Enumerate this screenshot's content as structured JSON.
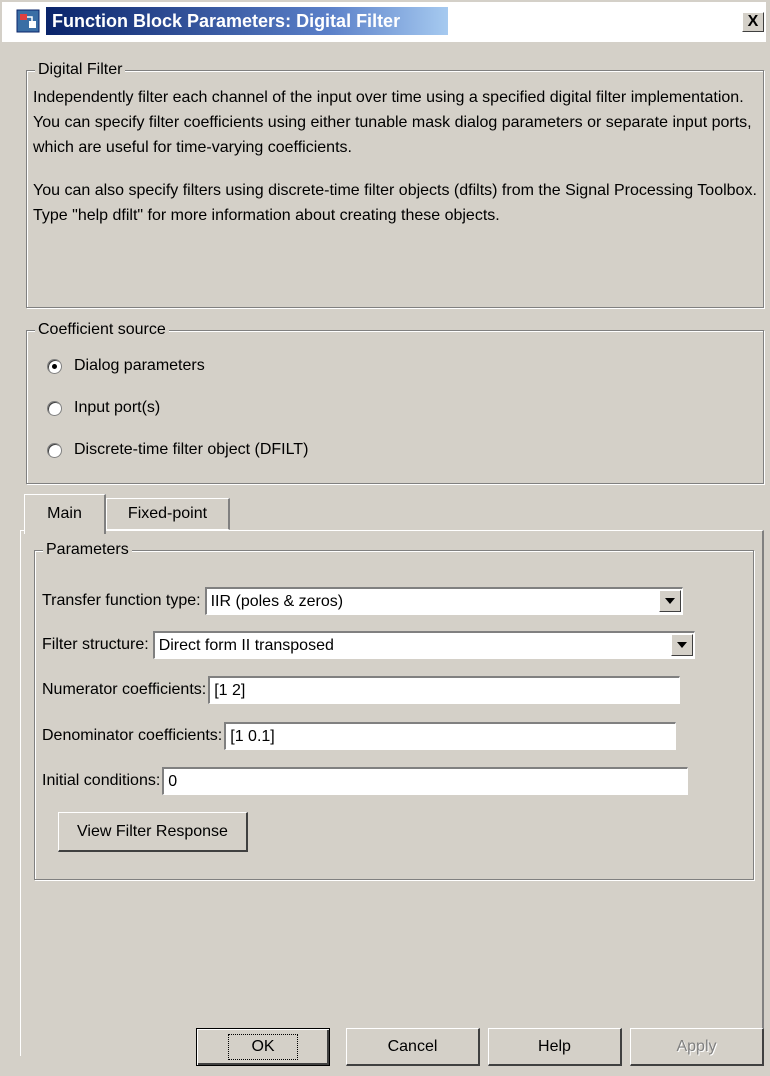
{
  "window": {
    "title": "Function Block Parameters: Digital Filter",
    "close_label": "X"
  },
  "description_group": {
    "legend": "Digital Filter",
    "paragraph1": "Independently filter each channel of the input over time using a specified digital filter implementation. You can specify filter coefficients using either tunable mask dialog parameters or separate input ports, which are useful for time-varying coefficients.",
    "paragraph2": "You can also specify filters using discrete-time filter objects (dfilts) from the Signal Processing Toolbox. Type \"help dfilt\" for more information about creating these objects."
  },
  "coefficient_source": {
    "legend": "Coefficient source",
    "options": [
      {
        "label": "Dialog parameters",
        "checked": true
      },
      {
        "label": "Input port(s)",
        "checked": false
      },
      {
        "label": "Discrete-time filter object (DFILT)",
        "checked": false
      }
    ]
  },
  "tabs": [
    {
      "label": "Main",
      "active": true
    },
    {
      "label": "Fixed-point",
      "active": false
    }
  ],
  "parameters": {
    "legend": "Parameters",
    "transfer_function_type": {
      "label": "Transfer function type:",
      "value": "IIR (poles & zeros)"
    },
    "filter_structure": {
      "label": "Filter structure:",
      "value": "Direct form II transposed"
    },
    "numerator": {
      "label": "Numerator coefficients:",
      "value": "[1 2]"
    },
    "denominator": {
      "label": "Denominator coefficients:",
      "value": "[1 0.1]"
    },
    "initial_conditions": {
      "label": "Initial conditions:",
      "value": "0"
    },
    "view_response_button": "View Filter Response"
  },
  "footer": {
    "ok": "OK",
    "cancel": "Cancel",
    "help": "Help",
    "apply": "Apply"
  },
  "icons": {
    "app_icon": "simulink-block-icon",
    "dropdown_icon": "triangle-down-icon"
  }
}
